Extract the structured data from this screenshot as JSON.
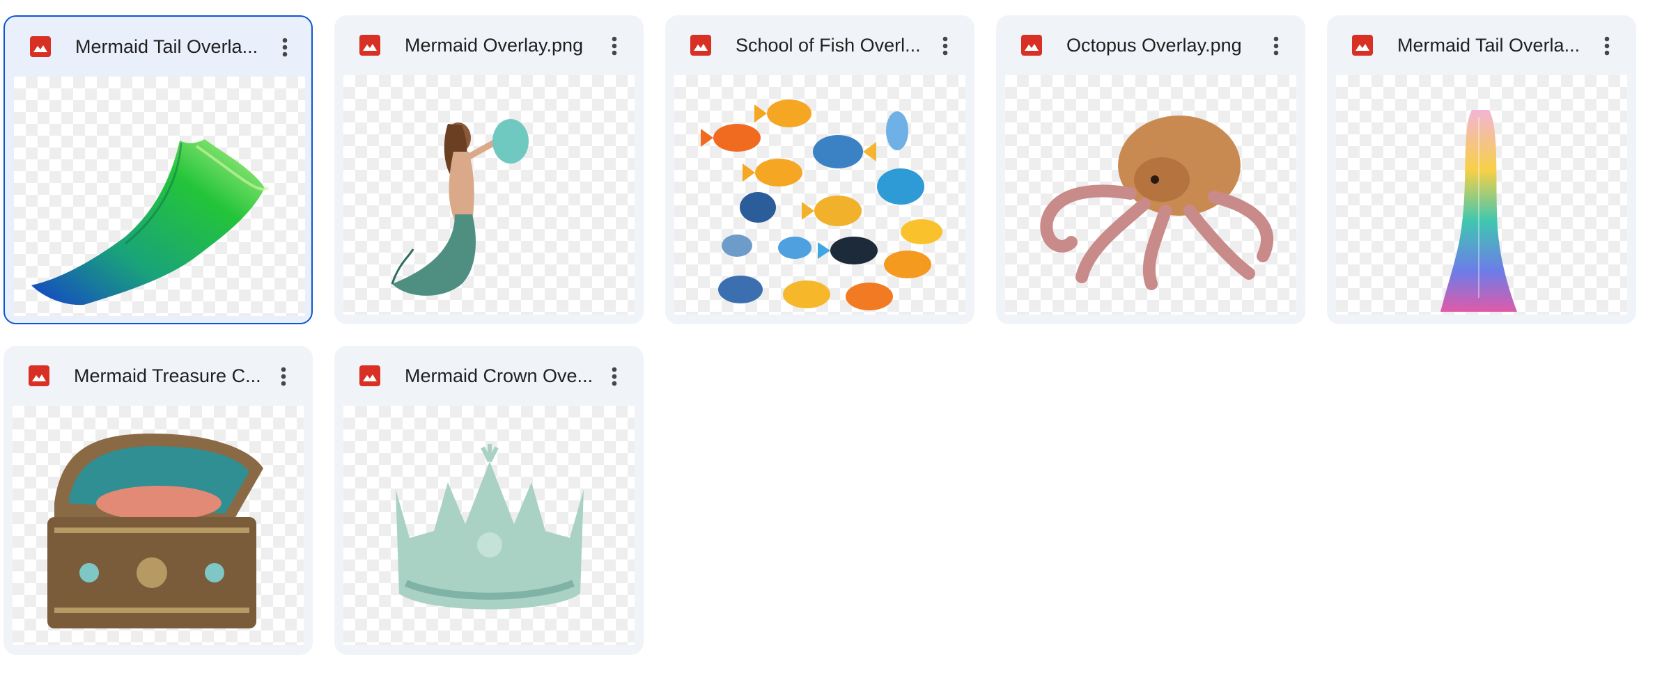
{
  "files": [
    {
      "name": "Mermaid Tail Overla...",
      "icon": "image-file-icon",
      "selected": true
    },
    {
      "name": "Mermaid Overlay.png",
      "icon": "image-file-icon",
      "selected": false
    },
    {
      "name": "School of Fish Overl...",
      "icon": "image-file-icon",
      "selected": false
    },
    {
      "name": "Octopus Overlay.png",
      "icon": "image-file-icon",
      "selected": false
    },
    {
      "name": "Mermaid Tail Overla...",
      "icon": "image-file-icon",
      "selected": false
    },
    {
      "name": "Mermaid Treasure C...",
      "icon": "image-file-icon",
      "selected": false
    },
    {
      "name": "Mermaid Crown Ove...",
      "icon": "image-file-icon",
      "selected": false
    }
  ],
  "colors": {
    "card_bg": "#f0f4f9",
    "selected_border": "#0b57d0",
    "file_icon_red": "#d93025",
    "text": "#1f1f1f"
  }
}
